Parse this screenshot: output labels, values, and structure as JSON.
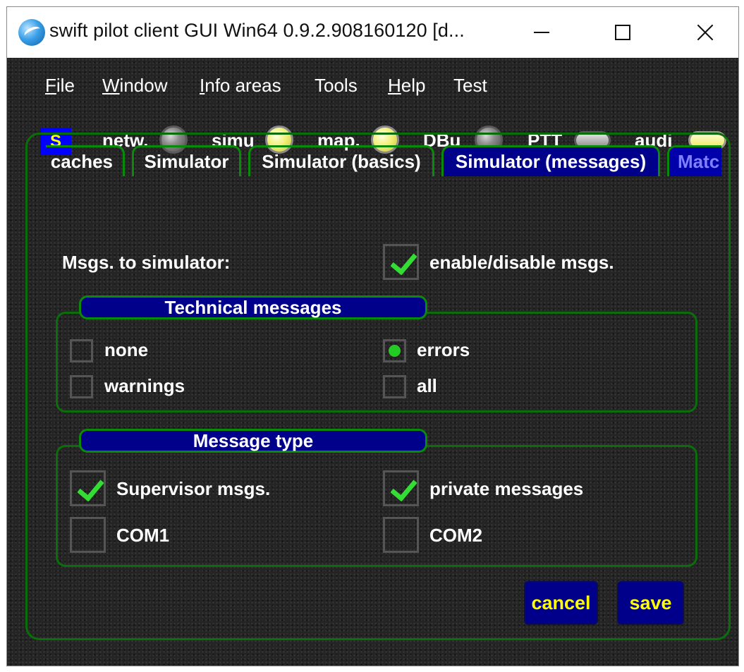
{
  "window": {
    "title": "swift pilot client GUI Win64 0.9.2.908160120 [d..."
  },
  "menu": {
    "items": [
      {
        "accel": "F",
        "rest": "ile"
      },
      {
        "accel": "W",
        "rest": "indow"
      },
      {
        "accel": "I",
        "rest": "nfo areas"
      },
      {
        "accel": "",
        "rest": "Tools"
      },
      {
        "accel": "H",
        "rest": "elp"
      },
      {
        "accel": "",
        "rest": "Test"
      }
    ]
  },
  "status": {
    "badge": "S",
    "indicators": [
      {
        "label": "netw.",
        "state": "off"
      },
      {
        "label": "simu",
        "state": "on"
      },
      {
        "label": "map.",
        "state": "on"
      },
      {
        "label": "DBu",
        "state": "off"
      },
      {
        "label": "PTT",
        "state": "off"
      },
      {
        "label": "audi",
        "state": "on"
      }
    ]
  },
  "tabs": [
    {
      "label": "caches",
      "active": false
    },
    {
      "label": "Simulator",
      "active": false
    },
    {
      "label": "Simulator (basics)",
      "active": false
    },
    {
      "label": "Simulator (messages)",
      "active": true
    },
    {
      "label": "Matc",
      "active": false
    }
  ],
  "msgs": {
    "label": "Msgs. to simulator:",
    "enable_label": "enable/disable msgs.",
    "enabled": true
  },
  "technical": {
    "title": "Technical messages",
    "options": {
      "none": "none",
      "warnings": "warnings",
      "errors": "errors",
      "all": "all"
    },
    "selected": "errors"
  },
  "message_type": {
    "title": "Message type",
    "supervisor": {
      "label": "Supervisor msgs.",
      "checked": true
    },
    "private": {
      "label": "private messages",
      "checked": true
    },
    "com1": {
      "label": "COM1",
      "checked": false
    },
    "com2": {
      "label": "COM2",
      "checked": false
    }
  },
  "buttons": {
    "cancel": "cancel",
    "save": "save"
  },
  "colors": {
    "accent_blue": "#00008b",
    "button_text": "#ffff00",
    "frame_green": "#0a6e0a",
    "check_green": "#33dd33"
  }
}
